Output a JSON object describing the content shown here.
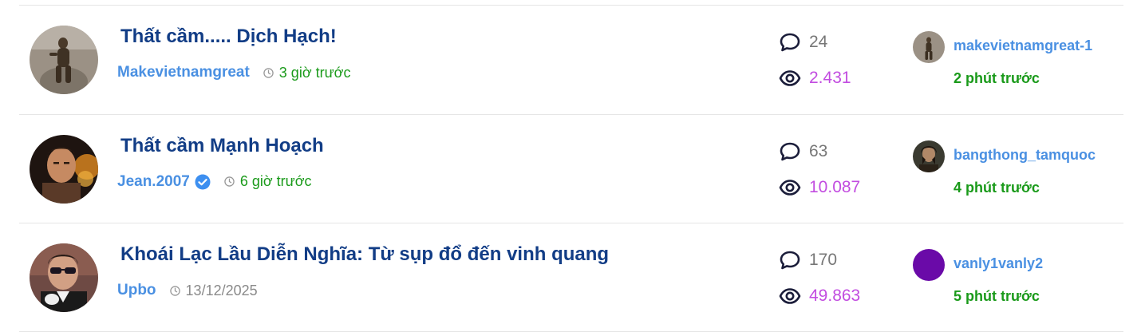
{
  "threads": [
    {
      "title": "Thất cầm..... Dịch Hạch!",
      "author": "Makevietnamgreat",
      "verified": false,
      "time": "3 giờ trước",
      "replies": "24",
      "views": "2.431",
      "last_user": "makevietnamgreat-1",
      "last_time": "2 phút trước",
      "avatar_icon": "statue-avatar"
    },
    {
      "title": "Thất cầm Mạnh Hoạch",
      "author": "Jean.2007",
      "verified": true,
      "time": "6 giờ trước",
      "replies": "63",
      "views": "10.087",
      "last_user": "bangthong_tamquoc",
      "last_time": "4 phút trước",
      "avatar_icon": "man-avatar"
    },
    {
      "title": "Khoái Lạc Lầu Diễn Nghĩa: Từ sụp đổ đến vinh quang",
      "author": "Upbo",
      "verified": false,
      "time": "13/12/2025",
      "replies": "170",
      "views": "49.863",
      "last_user": "vanly1vanly2",
      "last_time": "5 phút trước",
      "avatar_icon": "sunglasses-man-avatar"
    }
  ],
  "colors": {
    "title": "#123d86",
    "author": "#4a90e2",
    "recent_time": "#1a9a1a",
    "views": "#c24ce0",
    "replies": "#777777",
    "purple_avatar": "#6a0aa8"
  },
  "icons": {
    "replies": "speech-bubble-icon",
    "views": "eye-icon",
    "time": "clock-icon",
    "verified": "verified-badge-icon"
  }
}
